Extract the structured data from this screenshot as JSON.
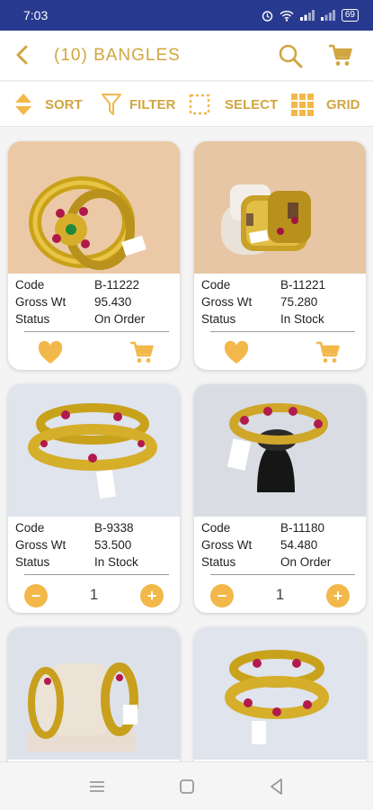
{
  "status_bar": {
    "time": "7:03",
    "battery": "69"
  },
  "header": {
    "title": "(10) BANGLES"
  },
  "toolbar": {
    "sort_label": "SORT",
    "filter_label": "FILTER",
    "select_label": "SELECT",
    "grid_label": "GRID"
  },
  "labels": {
    "code": "Code",
    "gross_wt": "Gross Wt",
    "status": "Status"
  },
  "products": [
    {
      "code": "B-11222",
      "gross_wt": "95.430",
      "status": "On Order"
    },
    {
      "code": "B-11221",
      "gross_wt": "75.280",
      "status": "In Stock"
    },
    {
      "code": "B-9338",
      "gross_wt": "53.500",
      "status": "In Stock",
      "quantity": "1"
    },
    {
      "code": "B-11180",
      "gross_wt": "54.480",
      "status": "On Order",
      "quantity": "1"
    }
  ],
  "colors": {
    "accent": "#d1a640",
    "status_bar": "#283a8f",
    "stepper": "#f2b84a"
  }
}
